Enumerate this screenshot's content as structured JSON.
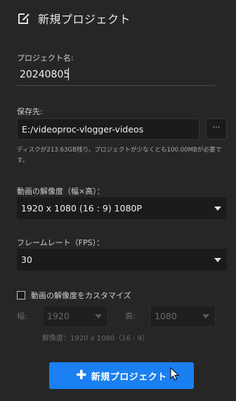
{
  "dialog": {
    "title": "新規プロジェクト",
    "title_icon": "edit-icon"
  },
  "project_name": {
    "label": "プロジェクト名:",
    "value": "20240805"
  },
  "save_location": {
    "label": "保存先:",
    "path": "E:/videoproc-vlogger-videos",
    "browse_label": "···",
    "hint": "ディスクが213.63GB残り、プロジェクトが少なくとも100.00MBが必要です。"
  },
  "resolution": {
    "label": "動画の解像度（幅×高）：",
    "selected": "1920 x 1080   (16 : 9)   1080P"
  },
  "frame_rate": {
    "label": "フレームレート（FPS）：",
    "selected": "30"
  },
  "custom_resolution": {
    "label": "動画の解像度をカスタマイズ",
    "checked": false,
    "width_label": "幅:",
    "width_value": "1920",
    "height_label": "高:",
    "height_value": "1080",
    "resolution_text": "解像度：1920 x 1080（16 : 9）"
  },
  "create_button": {
    "icon": "plus-icon",
    "label": "新規プロジェクト"
  },
  "colors": {
    "background": "#262626",
    "field": "#1b1b1b",
    "accent": "#1a7ff0"
  }
}
